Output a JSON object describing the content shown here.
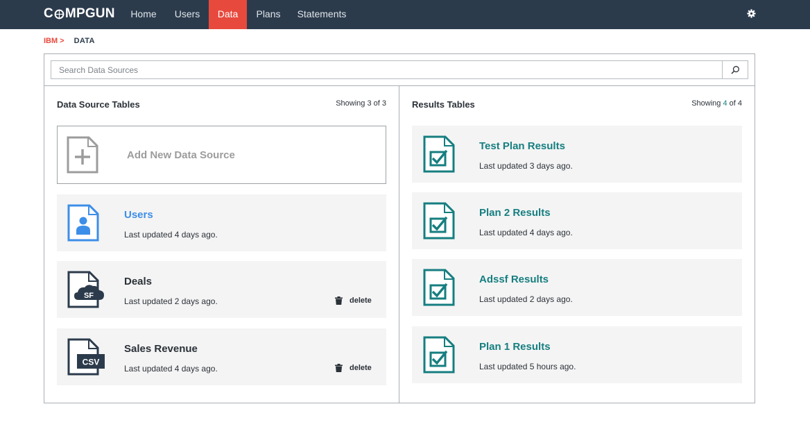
{
  "brand": {
    "logo_prefix": "C",
    "logo_suffix": "MPGUN",
    "accent_color": "#e8493d",
    "nav_bg": "#2c3b4c",
    "teal": "#167e80",
    "blue": "#3d8ee8"
  },
  "nav": {
    "items": [
      {
        "label": "Home",
        "active": false
      },
      {
        "label": "Users",
        "active": false
      },
      {
        "label": "Data",
        "active": true
      },
      {
        "label": "Plans",
        "active": false
      },
      {
        "label": "Statements",
        "active": false
      }
    ],
    "settings_icon": "gear-icon"
  },
  "breadcrumb": {
    "root": "IBM",
    "separator": ">",
    "current": "DATA"
  },
  "search": {
    "placeholder": "Search Data Sources",
    "value": "",
    "icon": "search-icon"
  },
  "data_sources": {
    "title": "Data Source Tables",
    "showing_prefix": "Showing ",
    "showing_count": "3",
    "showing_suffix": " of 3",
    "add_label": "Add New Data Source",
    "items": [
      {
        "name": "Users",
        "updated": "Last updated 4 days ago.",
        "icon": "user-file-icon",
        "deletable": false
      },
      {
        "name": "Deals",
        "updated": "Last updated 2 days ago.",
        "icon": "salesforce-file-icon",
        "icon_text": "SF",
        "deletable": true,
        "delete_label": "delete"
      },
      {
        "name": "Sales Revenue",
        "updated": "Last updated 4 days ago.",
        "icon": "csv-file-icon",
        "icon_text": "CSV",
        "deletable": true,
        "delete_label": "delete"
      }
    ]
  },
  "results": {
    "title": "Results Tables",
    "showing_prefix": "Showing ",
    "showing_count": "4",
    "showing_suffix": " of 4",
    "items": [
      {
        "name": "Test Plan Results",
        "updated": "Last updated 3 days ago.",
        "icon": "checked-file-icon"
      },
      {
        "name": "Plan 2 Results",
        "updated": "Last updated 4 days ago.",
        "icon": "checked-file-icon"
      },
      {
        "name": "Adssf Results",
        "updated": "Last updated 2 days ago.",
        "icon": "checked-file-icon"
      },
      {
        "name": "Plan 1 Results",
        "updated": "Last updated 5 hours ago.",
        "icon": "checked-file-icon"
      }
    ]
  }
}
